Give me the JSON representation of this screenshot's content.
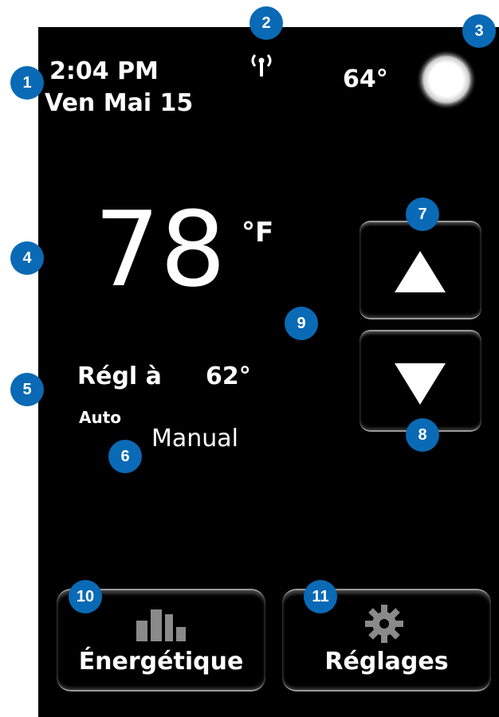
{
  "status": {
    "time": "2:04 PM",
    "date": "Ven Mai 15",
    "outdoor_temp": "64°",
    "weather_icon": "sun-icon",
    "signal_icon": "wireless-signal-icon"
  },
  "thermostat": {
    "current_temp": "78",
    "unit": "°F",
    "setpoint_label": "Régl à",
    "setpoint_value": "62°",
    "mode": "Auto"
  },
  "controls": {
    "up_icon": "up-arrow-icon",
    "down_icon": "down-arrow-icon"
  },
  "bottom_buttons": {
    "energy_label": "Énergétique",
    "energy_icon": "bar-chart-icon",
    "settings_label": "Réglages",
    "settings_icon": "gear-icon"
  },
  "callouts": {
    "badges": [
      "1",
      "2",
      "3",
      "4",
      "5",
      "6",
      "7",
      "8",
      "9",
      "10",
      "11"
    ],
    "manual_label": "Manual"
  },
  "colors": {
    "screen_bg": "#000000",
    "text": "#ffffff",
    "callout_badge": "#0a6ab5",
    "icon_gray": "#8a8a8a"
  }
}
